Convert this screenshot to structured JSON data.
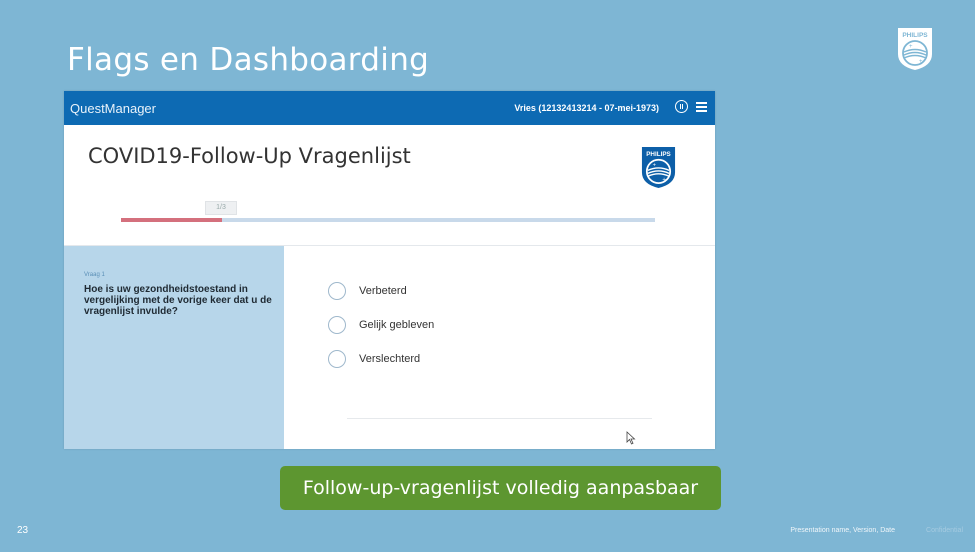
{
  "slide": {
    "title": "Flags en Dashboarding",
    "number": "23",
    "footer": "Presentation name, Version, Date",
    "footer_faint": "Confidential",
    "banner": "Follow-up-vragenlijst volledig aanpasbaar",
    "colors": {
      "background": "#7eb6d4",
      "banner": "#5d9630"
    }
  },
  "app": {
    "name": "QuestManager",
    "patient": "Vries (12132413214 - 07-mei-1973)",
    "bar_color": "#0d6ab3"
  },
  "questionnaire": {
    "title": "COVID19-Follow-Up Vragenlijst",
    "progress_label": "1/3",
    "progress": 0.19,
    "question_number": "Vraag 1",
    "question_text": "Hoe is uw gezondheidstoestand in vergelijking met de vorige keer dat u de vragenlijst invulde?",
    "options": [
      "Verbeterd",
      "Gelijk gebleven",
      "Verslechterd"
    ]
  },
  "icons": [
    "philips-logo-icon",
    "pause-icon",
    "menu-icon",
    "cursor-icon"
  ]
}
